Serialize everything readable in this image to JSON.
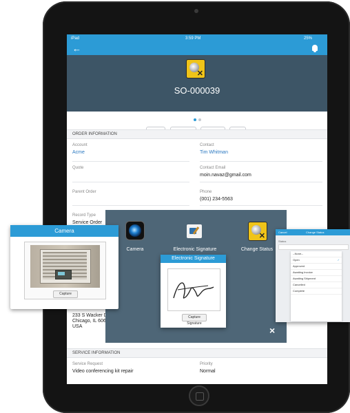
{
  "status_bar": {
    "carrier": "iPad",
    "time": "3:59 PM",
    "battery": "25%"
  },
  "record": {
    "title": "SO-000039"
  },
  "actions": {
    "edit": "Edit",
    "delete": "Delete",
    "clone": "Clone"
  },
  "order_section": {
    "heading": "ORDER INFORMATION",
    "account_label": "Account",
    "account_value": "Acme",
    "contact_label": "Contact",
    "contact_value": "Tim Whitman",
    "quote_label": "Quote",
    "email_label": "Contact Email",
    "email_value": "moin.navaz@gmail.com",
    "parent_label": "Parent Order",
    "phone_label": "Phone",
    "phone_value": "(001) 234-5563",
    "record_type_label": "Record Type",
    "record_type_value": "Service Order",
    "address_line1": "233 S Wacker D",
    "address_line2": "Chicago, IL 6060",
    "address_line3": "USA"
  },
  "service_section": {
    "heading": "SERVICE INFORMATION",
    "request_label": "Service Request",
    "request_value": "Video conferencing kit repair",
    "priority_label": "Priority",
    "priority_value": "Normal"
  },
  "overlay": {
    "camera_label": "Camera",
    "signature_label": "Electronic Signature",
    "status_label": "Change Status",
    "close": "×"
  },
  "camera_popup": {
    "title": "Camera",
    "capture": "Capture"
  },
  "signature_popup": {
    "title": "Electronic Signature",
    "capture": "Capture Signature"
  },
  "status_popup": {
    "cancel": "Cancel",
    "title": "Change Status",
    "field_label": "Status",
    "options": [
      "--None--",
      "Open",
      "Approved",
      "Awaiting Invoice",
      "Awaiting Shipment",
      "Cancelled",
      "Complete"
    ]
  },
  "colors": {
    "accent": "#2c9bd6",
    "header": "#3d5566",
    "overlay": "#4e6677",
    "icon_yellow": "#f0c419"
  }
}
